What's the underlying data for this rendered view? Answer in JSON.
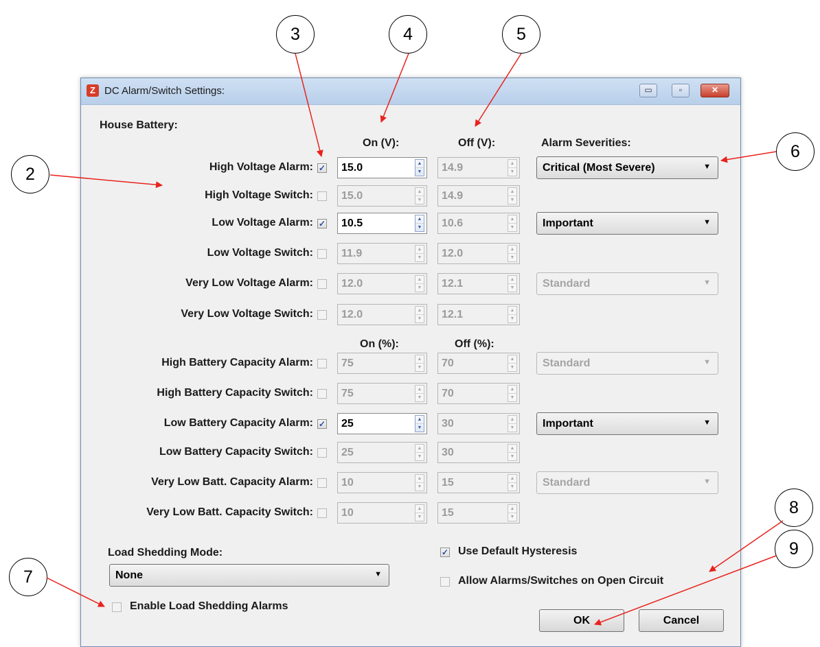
{
  "callouts": [
    "3",
    "4",
    "5",
    "2",
    "6",
    "8",
    "7",
    "9"
  ],
  "window": {
    "title": "DC Alarm/Switch Settings:",
    "app_icon_glyph": "Z",
    "controls": {
      "minimize": "▭",
      "maximize": "▫",
      "close": "✕"
    }
  },
  "section_title": "House Battery:",
  "headers": {
    "on_v": "On (V):",
    "off_v": "Off (V):",
    "alarm_severities": "Alarm Severities:",
    "on_pct": "On (%):",
    "off_pct": "Off (%):"
  },
  "rows": [
    {
      "label": "High Voltage Alarm:",
      "checked": true,
      "on": "15.0",
      "off": "14.9",
      "severity": "Critical (Most Severe)",
      "severity_enabled": true
    },
    {
      "label": "High Voltage Switch:",
      "checked": false,
      "on": "15.0",
      "off": "14.9"
    },
    {
      "label": "Low Voltage Alarm:",
      "checked": true,
      "on": "10.5",
      "off": "10.6",
      "severity": "Important",
      "severity_enabled": true
    },
    {
      "label": "Low Voltage Switch:",
      "checked": false,
      "on": "11.9",
      "off": "12.0"
    },
    {
      "label": "Very Low Voltage Alarm:",
      "checked": false,
      "on": "12.0",
      "off": "12.1",
      "severity": "Standard",
      "severity_enabled": false
    },
    {
      "label": "Very Low Voltage Switch:",
      "checked": false,
      "on": "12.0",
      "off": "12.1"
    },
    {
      "label": "High Battery Capacity Alarm:",
      "checked": false,
      "on": "75",
      "off": "70",
      "severity": "Standard",
      "severity_enabled": false
    },
    {
      "label": "High Battery Capacity Switch:",
      "checked": false,
      "on": "75",
      "off": "70"
    },
    {
      "label": "Low Battery Capacity Alarm:",
      "checked": true,
      "on": "25",
      "off": "30",
      "severity": "Important",
      "severity_enabled": true
    },
    {
      "label": "Low Battery Capacity Switch:",
      "checked": false,
      "on": "25",
      "off": "30"
    },
    {
      "label": "Very Low Batt. Capacity Alarm:",
      "checked": false,
      "on": "10",
      "off": "15",
      "severity": "Standard",
      "severity_enabled": false
    },
    {
      "label": "Very Low Batt. Capacity Switch:",
      "checked": false,
      "on": "10",
      "off": "15"
    }
  ],
  "load_shedding": {
    "mode_label": "Load Shedding Mode:",
    "mode_value": "None",
    "enable_alarms_label": "Enable Load Shedding Alarms",
    "enable_alarms_checked": false
  },
  "options": {
    "use_default_hysteresis_label": "Use Default Hysteresis",
    "use_default_hysteresis_checked": true,
    "allow_open_circuit_label": "Allow Alarms/Switches on Open Circuit",
    "allow_open_circuit_checked": false
  },
  "buttons": {
    "ok": "OK",
    "cancel": "Cancel"
  },
  "colors": {
    "annotation_arrow": "#e8231d",
    "checkmark": "#2a4fa0",
    "title_bar": "#c4d8f0"
  }
}
